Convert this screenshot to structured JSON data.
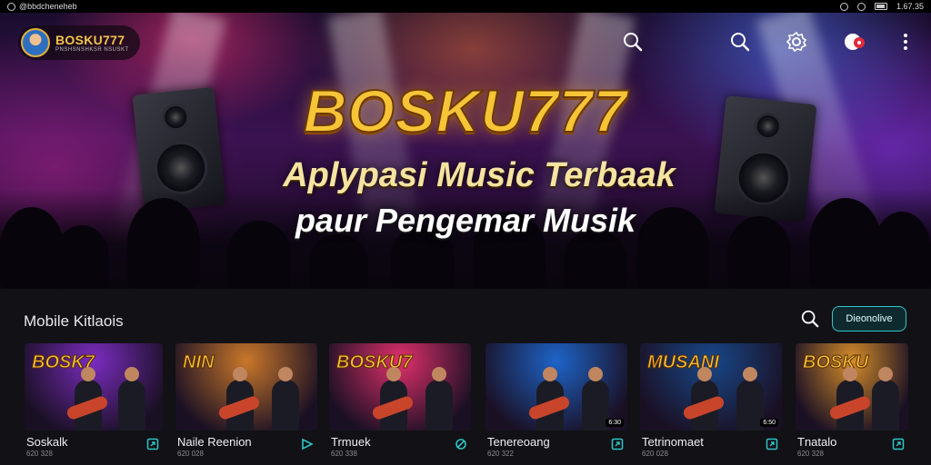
{
  "status_bar": {
    "left_text": "@bbdcheneheb",
    "time": "1.67.35"
  },
  "header": {
    "logo_title": "BOSKU777",
    "logo_subtitle": "PNSHSNSHKSR NSUSKT"
  },
  "hero": {
    "title": "BOSKU777",
    "line1": "Aplypasi Music Terbaak",
    "line2": "paur Pengemar Musik"
  },
  "icons": {
    "top": [
      "search-icon",
      "search-icon",
      "settings-icon",
      "notification-icon",
      "more-vertical-icon"
    ],
    "section": "search-icon"
  },
  "section": {
    "title": "Mobile Kitlaois",
    "button_label": "Dieonolive"
  },
  "cards": [
    {
      "thumb_label": "BOSK7",
      "title": "Soskalk",
      "subtitle": "620 328",
      "badge": "",
      "icon": "share-icon",
      "accent": "#7b2cbf"
    },
    {
      "thumb_label": "NIN",
      "title": "Naile Reenion",
      "subtitle": "620 028",
      "badge": "",
      "icon": "play-icon",
      "accent": "#c9772a"
    },
    {
      "thumb_label": "BOSKU7",
      "title": "Trmuek",
      "subtitle": "620 338",
      "badge": "",
      "icon": "headphones-icon",
      "accent": "#e0306a"
    },
    {
      "thumb_label": "",
      "title": "Tenereoang",
      "subtitle": "620 322",
      "badge": "6:30",
      "icon": "share-icon",
      "accent": "#1e64c8"
    },
    {
      "thumb_label": "MUSANI",
      "title": "Tetrinomaet",
      "subtitle": "620 028",
      "badge": "6:50",
      "icon": "share-icon",
      "accent": "#18488a"
    },
    {
      "thumb_label": "BOSKU",
      "title": "Tnatalo",
      "subtitle": "620 328",
      "badge": "",
      "icon": "share-icon",
      "accent": "#d48c2a"
    }
  ]
}
